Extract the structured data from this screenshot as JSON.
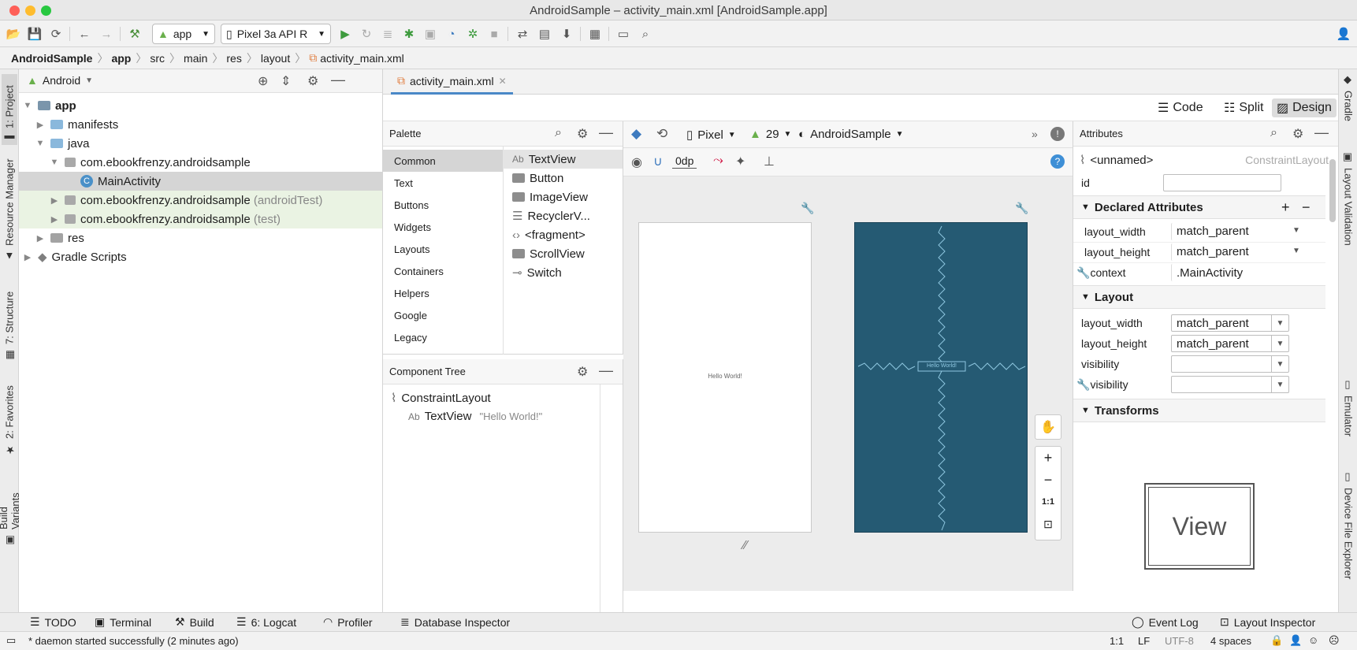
{
  "window": {
    "title": "AndroidSample – activity_main.xml [AndroidSample.app]"
  },
  "toolbar": {
    "run_config": "app",
    "device": "Pixel 3a API R"
  },
  "breadcrumb": [
    "AndroidSample",
    "app",
    "src",
    "main",
    "res",
    "layout",
    "activity_main.xml"
  ],
  "left_stripe": [
    "1: Project",
    "Resource Manager",
    "7: Structure",
    "2: Favorites",
    "Build Variants"
  ],
  "right_stripe": [
    "Gradle",
    "Layout Validation",
    "Emulator",
    "Device File Explorer"
  ],
  "project": {
    "view": "Android",
    "tree": [
      {
        "label": "app",
        "suffix": ""
      },
      {
        "label": "manifests",
        "suffix": ""
      },
      {
        "label": "java",
        "suffix": ""
      },
      {
        "label": "com.ebookfrenzy.androidsample",
        "suffix": ""
      },
      {
        "label": "MainActivity",
        "suffix": ""
      },
      {
        "label": "com.ebookfrenzy.androidsample",
        "suffix": "(androidTest)"
      },
      {
        "label": "com.ebookfrenzy.androidsample",
        "suffix": "(test)"
      },
      {
        "label": "res",
        "suffix": ""
      },
      {
        "label": "Gradle Scripts",
        "suffix": ""
      }
    ]
  },
  "editor": {
    "tab": "activity_main.xml",
    "modes": [
      "Code",
      "Split",
      "Design"
    ],
    "active_mode": "Design"
  },
  "palette": {
    "title": "Palette",
    "categories": [
      "Common",
      "Text",
      "Buttons",
      "Widgets",
      "Layouts",
      "Containers",
      "Helpers",
      "Google",
      "Legacy"
    ],
    "items": [
      "TextView",
      "Button",
      "ImageView",
      "RecyclerV...",
      "<fragment>",
      "ScrollView",
      "Switch"
    ],
    "textview_prefix": "Ab"
  },
  "component_tree": {
    "title": "Component Tree",
    "root": "ConstraintLayout",
    "child_prefix": "Ab",
    "child": "TextView",
    "child_text": "\"Hello World!\""
  },
  "design_toolbar": {
    "device": "Pixel",
    "api": "29",
    "theme": "AndroidSample",
    "margin": "0dp"
  },
  "canvas": {
    "hello": "Hello World!",
    "zoom": [
      "+",
      "−",
      "1:1"
    ]
  },
  "attributes": {
    "title": "Attributes",
    "component": "<unnamed>",
    "component_type": "ConstraintLayout",
    "id_label": "id",
    "declared_title": "Declared Attributes",
    "declared": [
      {
        "name": "layout_width",
        "value": "match_parent"
      },
      {
        "name": "layout_height",
        "value": "match_parent"
      },
      {
        "name": "context",
        "value": ".MainActivity"
      }
    ],
    "layout_title": "Layout",
    "layout": [
      {
        "name": "layout_width",
        "value": "match_parent"
      },
      {
        "name": "layout_height",
        "value": "match_parent"
      },
      {
        "name": "visibility",
        "value": ""
      },
      {
        "name": "visibility",
        "value": ""
      }
    ],
    "transforms_title": "Transforms",
    "view_label": "View"
  },
  "bottom_tools": {
    "left": [
      "TODO",
      "Terminal",
      "Build",
      "6: Logcat",
      "Profiler",
      "Database Inspector"
    ],
    "right": [
      "Event Log",
      "Layout Inspector"
    ]
  },
  "status": {
    "message": "* daemon started successfully (2 minutes ago)",
    "position": "1:1",
    "line_sep": "LF",
    "encoding": "UTF-8",
    "indent": "4 spaces"
  },
  "colors": {
    "blueprint": "#255a73",
    "accent": "#4a88c7",
    "run_green": "#3e9b3e"
  }
}
